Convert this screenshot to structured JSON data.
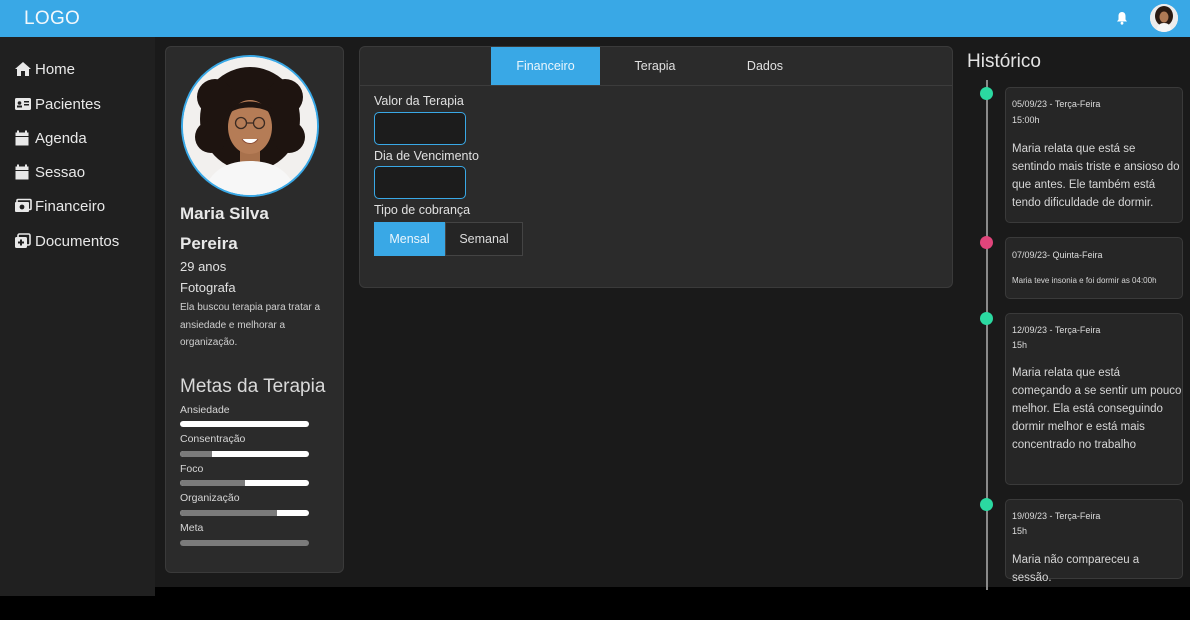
{
  "header": {
    "logo": "LOGO"
  },
  "sidebar": {
    "items": [
      {
        "label": "Home",
        "icon": "home-icon"
      },
      {
        "label": "Pacientes",
        "icon": "id-card-icon"
      },
      {
        "label": "Agenda",
        "icon": "calendar-icon"
      },
      {
        "label": "Sessao",
        "icon": "calendar-icon"
      },
      {
        "label": "Financeiro",
        "icon": "money-icon"
      },
      {
        "label": "Documentos",
        "icon": "documents-icon"
      }
    ]
  },
  "profile": {
    "name_line1": "Maria Silva",
    "name_line2": "Pereira",
    "age": "29 anos",
    "occupation": "Fotografa",
    "description": "Ela buscou terapia para tratar a ansiedade e melhorar a organização.",
    "goals_title": "Metas da Terapia",
    "goals": [
      {
        "label": "Ansiedade",
        "progress": 0.0
      },
      {
        "label": "Consentração",
        "progress": 0.25
      },
      {
        "label": "Foco",
        "progress": 0.5
      },
      {
        "label": "Organização",
        "progress": 0.75
      },
      {
        "label": "Meta",
        "progress": 1.0
      }
    ]
  },
  "panel": {
    "tabs": [
      {
        "label": "Financeiro",
        "active": true
      },
      {
        "label": "Terapia",
        "active": false
      },
      {
        "label": "Dados",
        "active": false
      }
    ],
    "fields": [
      {
        "label": "Valor da Terapia",
        "value": ""
      },
      {
        "label": "Dia de Vencimento",
        "value": ""
      }
    ],
    "billing_label": "Tipo de cobrança",
    "billing_options": [
      {
        "label": "Mensal",
        "selected": true
      },
      {
        "label": "Semanal",
        "selected": false
      }
    ]
  },
  "history": {
    "title": "Histórico",
    "entries": [
      {
        "date": "05/09/23 - Terça-Feira",
        "time": "15:00h",
        "text": "Maria relata que está se sentindo mais triste e ansioso do que antes. Ele também está tendo dificuldade de dormir.",
        "dot_color": "#2bd9a1"
      },
      {
        "date": "07/09/23- Quinta-Feira",
        "time": "",
        "text": "Maria teve insonia e foi dormir as 04:00h",
        "dot_color": "#e0457b"
      },
      {
        "date": "12/09/23 - Terça-Feira",
        "time": "15h",
        "text": "Maria relata que está começando a se sentir um pouco melhor. Ela está conseguindo dormir melhor e está mais concentrado no trabalho",
        "dot_color": "#2bd9a1"
      },
      {
        "date": "19/09/23 - Terça-Feira",
        "time": "15h",
        "text": "Maria não compareceu a sessão.",
        "dot_color": "#2bd9a1"
      }
    ]
  },
  "colors": {
    "accent": "#39a8e6",
    "dot_green": "#2bd9a1",
    "dot_pink": "#e0457b"
  }
}
